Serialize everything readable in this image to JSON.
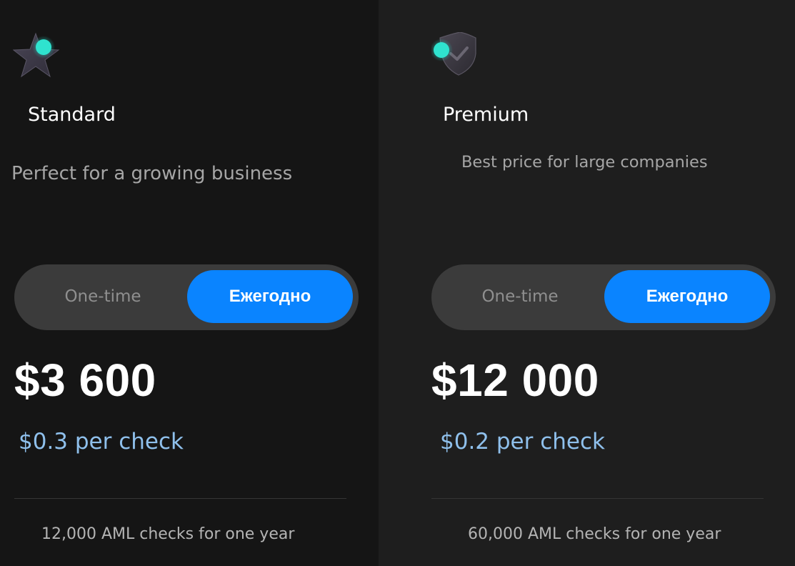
{
  "plans": [
    {
      "id": "standard",
      "icon": "star-icon",
      "name": "Standard",
      "description": "Perfect for a growing business",
      "billing": {
        "one_time_label": "One-time",
        "annual_label": "Ежегодно",
        "selected": "annual"
      },
      "price": "$3 600",
      "per_check": "$0.3 per check",
      "feature": "12,000 AML checks for one year"
    },
    {
      "id": "premium",
      "icon": "shield-check-icon",
      "name": "Premium",
      "description": "Best price for large companies",
      "billing": {
        "one_time_label": "One-time",
        "annual_label": "Ежегодно",
        "selected": "annual"
      },
      "price": "$12 000",
      "per_check": "$0.2 per check",
      "feature": "60,000 AML checks for one year"
    }
  ],
  "colors": {
    "accent": "#0a84ff",
    "per_check_text": "#8fc0ec",
    "icon_glow": "#2ee6d0",
    "standard_bg": "#151515",
    "premium_bg": "#1e1e1e",
    "toggle_bg": "#3b3b3b"
  }
}
